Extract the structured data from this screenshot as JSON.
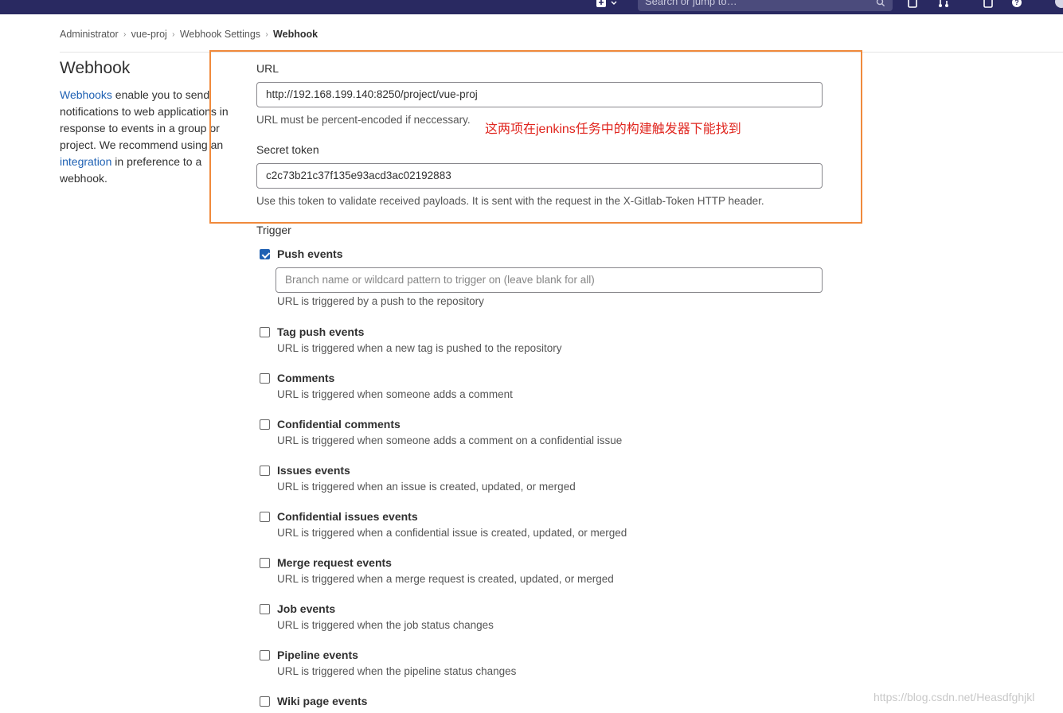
{
  "topbar": {
    "search_placeholder": "Search or jump to…",
    "icons": [
      "plus-icon",
      "merge-request-icon",
      "todo-icon",
      "help-icon"
    ]
  },
  "breadcrumb": {
    "items": [
      "Administrator",
      "vue-proj",
      "Webhook Settings",
      "Webhook"
    ]
  },
  "sidebar": {
    "title": "Webhook",
    "desc_link1": "Webhooks",
    "desc_text1": " enable you to send notifications to web applications in response to events in a group or project. We recommend using an ",
    "desc_link2": "integration",
    "desc_text2": " in preference to a webhook."
  },
  "form": {
    "url_label": "URL",
    "url_value": "http://192.168.199.140:8250/project/vue-proj",
    "url_help": "URL must be percent-encoded if neccessary.",
    "annotation": "这两项在jenkins任务中的构建触发器下能找到",
    "secret_label": "Secret token",
    "secret_value": "c2c73b21c37f135e93acd3ac02192883",
    "secret_help": "Use this token to validate received payloads. It is sent with the request in the X-Gitlab-Token HTTP header.",
    "trigger_label": "Trigger",
    "branch_placeholder": "Branch name or wildcard pattern to trigger on (leave blank for all)"
  },
  "events": [
    {
      "name": "Push events",
      "desc": "URL is triggered by a push to the repository",
      "checked": true
    },
    {
      "name": "Tag push events",
      "desc": "URL is triggered when a new tag is pushed to the repository",
      "checked": false
    },
    {
      "name": "Comments",
      "desc": "URL is triggered when someone adds a comment",
      "checked": false
    },
    {
      "name": "Confidential comments",
      "desc": "URL is triggered when someone adds a comment on a confidential issue",
      "checked": false
    },
    {
      "name": "Issues events",
      "desc": "URL is triggered when an issue is created, updated, or merged",
      "checked": false
    },
    {
      "name": "Confidential issues events",
      "desc": "URL is triggered when a confidential issue is created, updated, or merged",
      "checked": false
    },
    {
      "name": "Merge request events",
      "desc": "URL is triggered when a merge request is created, updated, or merged",
      "checked": false
    },
    {
      "name": "Job events",
      "desc": "URL is triggered when the job status changes",
      "checked": false
    },
    {
      "name": "Pipeline events",
      "desc": "URL is triggered when the pipeline status changes",
      "checked": false
    },
    {
      "name": "Wiki page events",
      "desc": "",
      "checked": false
    }
  ],
  "watermark": "https://blog.csdn.net/Heasdfghjkl",
  "colors": {
    "nav": "#292961",
    "link": "#1f61b3",
    "highlight": "#f08a3c",
    "annotation": "#e0261f",
    "checkbox_checked": "#1f61b3"
  }
}
